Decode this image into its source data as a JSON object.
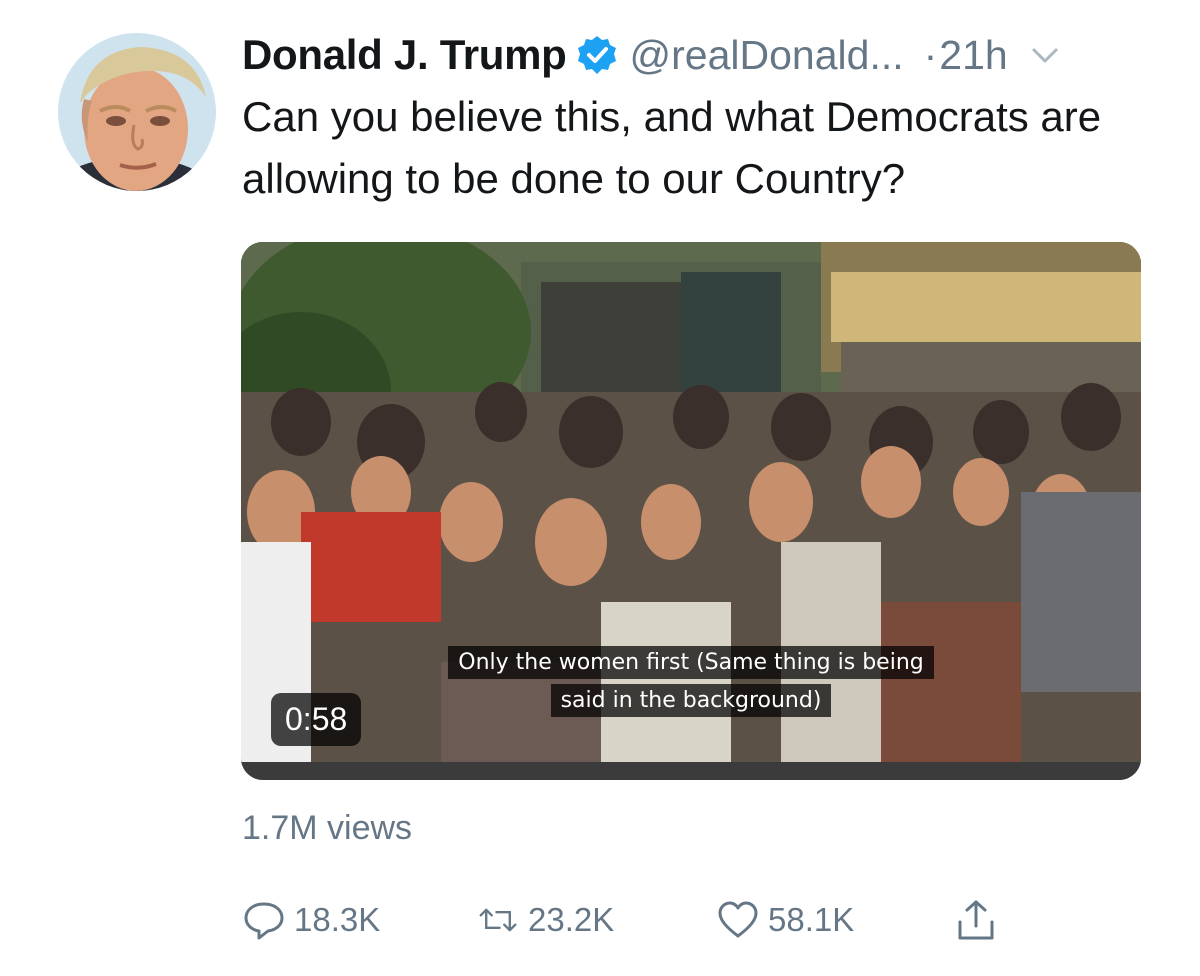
{
  "tweet": {
    "author_name": "Donald J. Trump",
    "handle": "@realDonald...",
    "separator": "·",
    "time": "21h",
    "text": "Can you believe this, and what Democrats are allowing to be done to our Country?",
    "verified_icon": "verified-badge-icon",
    "menu_icon": "chevron-down-icon"
  },
  "media": {
    "subtitle_line1": "Only the women first (Same thing is being",
    "subtitle_line2": "said in the background)",
    "duration": "0:58"
  },
  "stats": {
    "views": "1.7M views"
  },
  "actions": {
    "reply_count": "18.3K",
    "retweet_count": "23.2K",
    "like_count": "58.1K",
    "reply_icon": "speech-bubble-icon",
    "retweet_icon": "retweet-arrows-icon",
    "like_icon": "heart-outline-icon",
    "share_icon": "share-upload-icon"
  },
  "colors": {
    "text": "#14171a",
    "secondary": "#657786",
    "verified_blue": "#1da1f2"
  }
}
